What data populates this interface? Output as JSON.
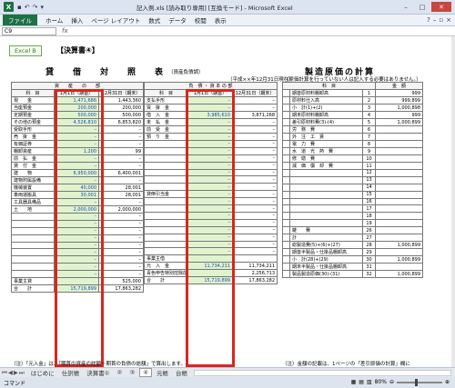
{
  "window": {
    "title": "記入例.xls [読み取り専用] [互換モード] - Microsoft Excel",
    "buttons": [
      "–",
      "□",
      "✕"
    ]
  },
  "ribbon": {
    "file_tab": "ファイル",
    "tabs": [
      "ホーム",
      "挿入",
      "ページ レイアウト",
      "数式",
      "データ",
      "校閲",
      "表示"
    ]
  },
  "formula_bar": {
    "name_box": "C9",
    "fx": "fx",
    "value": ""
  },
  "sheet": {
    "tag": "Excel B",
    "heading": "【決算書④】",
    "bs_title": "貸　借　対　照　表",
    "bs_subtitle": "（資産負債調）",
    "bs_date_note": "（平成××年12月31日現在）",
    "mfg_title": "製造原価の計算",
    "mfg_note": "（原価計算を行っていない人は記入する必要はありません。）",
    "asset_header": "資　　産　　の　　部",
    "liab_header": "負　債 ・ 資 本 の 部",
    "col_item": "科　目",
    "col_jan": "1月1日（期首）",
    "col_dec": "12月31日（期末）",
    "mfg_col_item": "科　目",
    "mfg_col_amount": "金　額",
    "assets": [
      {
        "item": "現　　金",
        "jan": "1,471,686",
        "dec": "1,443,360"
      },
      {
        "item": "当座預金",
        "jan": "200,000",
        "dec": "200,000"
      },
      {
        "item": "定期預金",
        "jan": "500,000",
        "dec": "500,000"
      },
      {
        "item": "その他の預金",
        "jan": "4,526,810",
        "dec": "6,853,820"
      },
      {
        "item": "受取手形",
        "jan": "–",
        "dec": "–"
      },
      {
        "item": "売　掛　金",
        "jan": "–",
        "dec": "–"
      },
      {
        "item": "有価証券",
        "jan": "–",
        "dec": "–"
      },
      {
        "item": "棚卸資産",
        "jan": "1,200",
        "dec": "99"
      },
      {
        "item": "前　払　金",
        "jan": "–",
        "dec": "–"
      },
      {
        "item": "貸　付　金",
        "jan": "–",
        "dec": "–"
      },
      {
        "item": "建　　物",
        "jan": "6,950,000",
        "dec": "6,400,001"
      },
      {
        "item": "建物附属設備",
        "jan": "–",
        "dec": "–"
      },
      {
        "item": "機械装置",
        "jan": "40,000",
        "dec": "28,001"
      },
      {
        "item": "車両運搬具",
        "jan": "30,001",
        "dec": "28,001"
      },
      {
        "item": "工具器具備品",
        "jan": "–",
        "dec": "–"
      },
      {
        "item": "土　　地",
        "jan": "2,000,000",
        "dec": "2,000,000"
      },
      {
        "item": "",
        "jan": "–",
        "dec": "–"
      },
      {
        "item": "",
        "jan": "–",
        "dec": "–"
      },
      {
        "item": "",
        "jan": "–",
        "dec": "–"
      },
      {
        "item": "",
        "jan": "–",
        "dec": "–"
      },
      {
        "item": "",
        "jan": "–",
        "dec": "–"
      },
      {
        "item": "",
        "jan": "–",
        "dec": "–"
      },
      {
        "item": "",
        "jan": "–",
        "dec": "–"
      },
      {
        "item": "",
        "jan": "–",
        "dec": "–"
      },
      {
        "item": "",
        "jan": "–",
        "dec": "–"
      },
      {
        "item": "事業主貸",
        "jan": "",
        "dec": "525,000"
      },
      {
        "item": "合　　計",
        "jan": "15,719,899",
        "dec": "17,863,282"
      }
    ],
    "liabilities": [
      {
        "item": "支払手形",
        "jan": "–",
        "dec": "–"
      },
      {
        "item": "買　掛　金",
        "jan": "–",
        "dec": "–"
      },
      {
        "item": "借　入　金",
        "jan": "3,985,610",
        "dec": "3,871,268"
      },
      {
        "item": "未　払　金",
        "jan": "–",
        "dec": "–"
      },
      {
        "item": "前　受　金",
        "jan": "–",
        "dec": "–"
      },
      {
        "item": "預　り　金",
        "jan": "–",
        "dec": "–"
      },
      {
        "item": "",
        "jan": "–",
        "dec": "–"
      },
      {
        "item": "",
        "jan": "–",
        "dec": "–"
      },
      {
        "item": "",
        "jan": "–",
        "dec": "–"
      },
      {
        "item": "",
        "jan": "–",
        "dec": "–"
      },
      {
        "item": "",
        "jan": "–",
        "dec": "–"
      },
      {
        "item": "",
        "jan": "–",
        "dec": "–"
      },
      {
        "item": "",
        "jan": "–",
        "dec": "–"
      },
      {
        "item": "貸倒引当金",
        "jan": "–",
        "dec": "–"
      },
      {
        "item": "",
        "jan": "–",
        "dec": "–"
      },
      {
        "item": "",
        "jan": "–",
        "dec": "–"
      },
      {
        "item": "",
        "jan": "–",
        "dec": "–"
      },
      {
        "item": "",
        "jan": "–",
        "dec": "–"
      },
      {
        "item": "",
        "jan": "–",
        "dec": "–"
      },
      {
        "item": "",
        "jan": "–",
        "dec": "–"
      },
      {
        "item": "",
        "jan": "–",
        "dec": "–"
      },
      {
        "item": "",
        "jan": "–",
        "dec": "–"
      },
      {
        "item": "事業主借",
        "jan": "",
        "dec": ""
      },
      {
        "item": "元　入　金",
        "jan": "11,734,211",
        "dec": "11,734,211"
      },
      {
        "item": "青色申告特別控除前の所得金額",
        "jan": "",
        "dec": "2,256,713"
      },
      {
        "item": "合　　計",
        "jan": "15,719,899",
        "dec": "17,863,282"
      }
    ],
    "mfg": [
      {
        "no": "",
        "item": "期首原材料棚卸高",
        "num": "1",
        "amount": "999"
      },
      {
        "no": "",
        "item": "原材料仕入高",
        "num": "2",
        "amount": "999,899"
      },
      {
        "no": "",
        "item": "小　計(1)+(2)",
        "num": "3",
        "amount": "1,000,898"
      },
      {
        "no": "",
        "item": "期末原材料棚卸高",
        "num": "4",
        "amount": "999"
      },
      {
        "no": "",
        "item": "差引原材料費(3)-(4)",
        "num": "5",
        "amount": "1,000,899"
      },
      {
        "no": "",
        "item": "労　務　費",
        "num": "6",
        "amount": ""
      },
      {
        "no": "",
        "item": "外　注　工　賃",
        "num": "7",
        "amount": ""
      },
      {
        "no": "",
        "item": "電　力　費",
        "num": "8",
        "amount": ""
      },
      {
        "no": "",
        "item": "水　道　光　熱　費",
        "num": "9",
        "amount": ""
      },
      {
        "no": "",
        "item": "修　繕　費",
        "num": "10",
        "amount": ""
      },
      {
        "no": "",
        "item": "減　価　償　却　費",
        "num": "11",
        "amount": ""
      },
      {
        "no": "",
        "item": "",
        "num": "12",
        "amount": ""
      },
      {
        "no": "",
        "item": "",
        "num": "13",
        "amount": ""
      },
      {
        "no": "",
        "item": "",
        "num": "14",
        "amount": ""
      },
      {
        "no": "",
        "item": "",
        "num": "15",
        "amount": ""
      },
      {
        "no": "",
        "item": "",
        "num": "16",
        "amount": ""
      },
      {
        "no": "",
        "item": "",
        "num": "17",
        "amount": ""
      },
      {
        "no": "",
        "item": "",
        "num": "18",
        "amount": ""
      },
      {
        "no": "",
        "item": "",
        "num": "19",
        "amount": ""
      },
      {
        "no": "",
        "item": "雑　　費",
        "num": "26",
        "amount": ""
      },
      {
        "no": "",
        "item": "計",
        "num": "27",
        "amount": ""
      },
      {
        "no": "",
        "item": "総製造費(5)+(6)+(27)",
        "num": "28",
        "amount": "1,000,899"
      },
      {
        "no": "",
        "item": "期首半製品・仕掛品棚卸高",
        "num": "29",
        "amount": ""
      },
      {
        "no": "",
        "item": "小　計(28)+(29)",
        "num": "30",
        "amount": "1,000,899"
      },
      {
        "no": "",
        "item": "期末半製品・仕掛品棚卸高",
        "num": "31",
        "amount": ""
      },
      {
        "no": "",
        "item": "製品製造原価(30)-(31)",
        "num": "32",
        "amount": "1,000,899"
      }
    ],
    "footnote_left": "（注）「元入金」は、「期首の資産の総額－期首の負債の総額」で算出します。",
    "footnote_right": "（注）金額の記載は、1ページの「差引原価の計算」欄に"
  },
  "sheet_tabs": [
    "はじめに",
    "仕訳帳",
    "決算書①",
    "②",
    "③",
    "④",
    "元帳",
    "台帳"
  ],
  "selected_tab_index": 5,
  "status": {
    "mode": "コマンド",
    "zoom": "80%",
    "zoom_level_percent": 80
  },
  "colors": {
    "input_cell": "#e0f3cf",
    "highlight_border": "#d9261c",
    "excel_green": "#1e7145"
  }
}
